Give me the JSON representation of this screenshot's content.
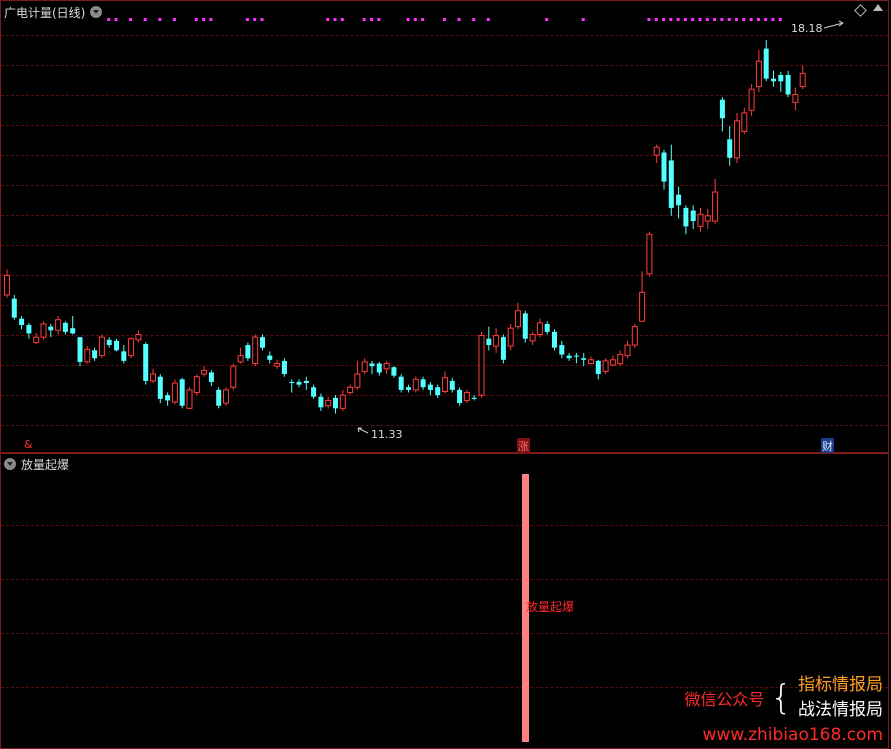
{
  "main_panel": {
    "title": "广电计量(日线)"
  },
  "sub_panel": {
    "title": "放量起爆",
    "bar_label": "放量起爆"
  },
  "signals": {
    "left_marker": "&",
    "up_badge": "涨",
    "fin_badge": "财"
  },
  "annotations": {
    "high_price": "18.18",
    "low_price": "11.33"
  },
  "watermark": {
    "wechat": "微信公众号",
    "brace": "{",
    "name1": "指标情报局",
    "name2": "战法情报局",
    "url": "www.zhibiao168.com"
  },
  "colors": {
    "bull": "#ff3c3c",
    "bear": "#54ffff",
    "dots": "#ff33ff",
    "volume_bar": "#ff8080"
  },
  "chart_data": {
    "type": "candlestick",
    "price_range": [
      10.6,
      18.6
    ],
    "candles": [
      [
        13.35,
        13.72,
        13.83,
        13.3
      ],
      [
        13.28,
        12.92,
        13.35,
        12.88
      ],
      [
        12.9,
        12.78,
        12.95,
        12.7
      ],
      [
        12.78,
        12.62,
        12.82,
        12.52
      ],
      [
        12.45,
        12.55,
        12.63,
        12.42
      ],
      [
        12.55,
        12.8,
        12.85,
        12.5
      ],
      [
        12.75,
        12.68,
        12.8,
        12.55
      ],
      [
        12.68,
        12.88,
        12.95,
        12.6
      ],
      [
        12.82,
        12.65,
        12.85,
        12.6
      ],
      [
        12.72,
        12.62,
        12.95,
        12.6
      ],
      [
        12.55,
        12.08,
        12.55,
        12.0
      ],
      [
        12.08,
        12.32,
        12.38,
        12.05
      ],
      [
        12.3,
        12.15,
        12.35,
        12.1
      ],
      [
        12.2,
        12.55,
        12.6,
        12.15
      ],
      [
        12.5,
        12.4,
        12.55,
        12.35
      ],
      [
        12.48,
        12.3,
        12.52,
        12.28
      ],
      [
        12.28,
        12.1,
        12.4,
        12.05
      ],
      [
        12.2,
        12.52,
        12.55,
        12.15
      ],
      [
        12.5,
        12.6,
        12.68,
        12.45
      ],
      [
        12.42,
        11.72,
        12.45,
        11.65
      ],
      [
        11.72,
        11.85,
        11.95,
        11.68
      ],
      [
        11.8,
        11.38,
        11.85,
        11.3
      ],
      [
        11.45,
        11.35,
        11.5,
        11.25
      ],
      [
        11.32,
        11.68,
        11.75,
        11.28
      ],
      [
        11.75,
        11.25,
        11.78,
        11.2
      ],
      [
        11.2,
        11.55,
        11.6,
        11.18
      ],
      [
        11.5,
        11.8,
        11.85,
        11.45
      ],
      [
        11.85,
        11.92,
        12.0,
        11.8
      ],
      [
        11.88,
        11.7,
        11.92,
        11.62
      ],
      [
        11.55,
        11.25,
        11.6,
        11.2
      ],
      [
        11.3,
        11.55,
        11.6,
        11.25
      ],
      [
        11.6,
        12.0,
        12.05,
        11.55
      ],
      [
        12.08,
        12.2,
        12.35,
        12.05
      ],
      [
        12.4,
        12.15,
        12.45,
        12.1
      ],
      [
        12.05,
        12.55,
        12.6,
        12.0
      ],
      [
        12.55,
        12.35,
        12.6,
        12.3
      ],
      [
        12.2,
        12.12,
        12.28,
        12.05
      ],
      [
        12.0,
        12.05,
        12.12,
        11.95
      ],
      [
        12.1,
        11.85,
        12.15,
        11.8
      ],
      [
        11.7,
        11.68,
        11.75,
        11.5
      ],
      [
        11.7,
        11.65,
        11.75,
        11.6
      ],
      [
        11.72,
        11.68,
        11.8,
        11.55
      ],
      [
        11.6,
        11.42,
        11.65,
        11.38
      ],
      [
        11.42,
        11.22,
        11.48,
        11.15
      ],
      [
        11.25,
        11.35,
        11.42,
        11.2
      ],
      [
        11.4,
        11.2,
        11.45,
        11.1
      ],
      [
        11.2,
        11.45,
        11.55,
        11.15
      ],
      [
        11.5,
        11.6,
        11.65,
        11.45
      ],
      [
        11.6,
        11.85,
        12.1,
        11.55
      ],
      [
        11.9,
        12.08,
        12.15,
        11.85
      ],
      [
        12.05,
        12.0,
        12.1,
        11.85
      ],
      [
        12.05,
        11.88,
        12.08,
        11.82
      ],
      [
        11.95,
        12.05,
        12.1,
        11.85
      ],
      [
        11.98,
        11.82,
        12.0,
        11.78
      ],
      [
        11.8,
        11.55,
        11.85,
        11.5
      ],
      [
        11.6,
        11.55,
        11.65,
        11.5
      ],
      [
        11.55,
        11.75,
        11.8,
        11.5
      ],
      [
        11.75,
        11.6,
        11.8,
        11.55
      ],
      [
        11.65,
        11.55,
        11.7,
        11.45
      ],
      [
        11.6,
        11.45,
        11.65,
        11.4
      ],
      [
        11.52,
        11.78,
        11.9,
        11.48
      ],
      [
        11.72,
        11.55,
        11.78,
        11.5
      ],
      [
        11.55,
        11.3,
        11.6,
        11.25
      ],
      [
        11.35,
        11.5,
        11.55,
        11.3
      ],
      [
        11.4,
        11.38,
        11.45,
        11.35
      ],
      [
        11.45,
        12.58,
        12.65,
        11.4
      ],
      [
        12.52,
        12.4,
        12.75,
        12.3
      ],
      [
        12.38,
        12.58,
        12.72,
        12.25
      ],
      [
        12.55,
        12.12,
        12.6,
        12.05
      ],
      [
        12.38,
        12.72,
        12.8,
        12.3
      ],
      [
        12.75,
        13.05,
        13.2,
        12.7
      ],
      [
        13.0,
        12.52,
        13.05,
        12.45
      ],
      [
        12.48,
        12.6,
        12.65,
        12.4
      ],
      [
        12.6,
        12.82,
        12.9,
        12.55
      ],
      [
        12.8,
        12.65,
        12.85,
        12.6
      ],
      [
        12.65,
        12.35,
        12.7,
        12.3
      ],
      [
        12.4,
        12.22,
        12.48,
        12.15
      ],
      [
        12.2,
        12.15,
        12.25,
        12.1
      ],
      [
        12.2,
        12.18,
        12.25,
        12.05
      ],
      [
        12.15,
        12.12,
        12.25,
        12.0
      ],
      [
        12.05,
        12.12,
        12.18,
        12.05
      ],
      [
        12.1,
        11.85,
        12.12,
        11.75
      ],
      [
        11.9,
        12.1,
        12.15,
        11.85
      ],
      [
        12.02,
        12.12,
        12.2,
        12.0
      ],
      [
        12.05,
        12.22,
        12.3,
        12.0
      ],
      [
        12.2,
        12.4,
        12.48,
        12.15
      ],
      [
        12.4,
        12.75,
        12.8,
        12.35
      ],
      [
        12.85,
        13.4,
        13.8,
        12.85
      ],
      [
        13.75,
        14.5,
        14.55,
        13.7
      ],
      [
        16.0,
        16.15,
        16.2,
        15.85
      ],
      [
        16.05,
        15.5,
        16.1,
        15.35
      ],
      [
        15.9,
        15.0,
        16.2,
        14.85
      ],
      [
        15.25,
        15.05,
        15.4,
        14.8
      ],
      [
        15.0,
        14.65,
        15.05,
        14.5
      ],
      [
        14.95,
        14.75,
        15.05,
        14.6
      ],
      [
        14.65,
        14.88,
        15.0,
        14.55
      ],
      [
        14.75,
        14.85,
        14.98,
        14.6
      ],
      [
        14.75,
        15.3,
        15.55,
        14.7
      ],
      [
        17.05,
        16.7,
        17.1,
        16.45
      ],
      [
        16.3,
        15.95,
        16.55,
        15.8
      ],
      [
        15.95,
        16.65,
        16.8,
        15.85
      ],
      [
        16.45,
        16.8,
        16.9,
        16.4
      ],
      [
        16.85,
        17.25,
        17.35,
        16.75
      ],
      [
        17.3,
        17.78,
        18.0,
        17.2
      ],
      [
        18.02,
        17.45,
        18.18,
        17.4
      ],
      [
        17.45,
        17.4,
        17.6,
        17.3
      ],
      [
        17.52,
        17.4,
        17.58,
        17.2
      ],
      [
        17.52,
        17.15,
        17.6,
        17.1
      ],
      [
        17.0,
        17.15,
        17.28,
        16.85
      ],
      [
        17.3,
        17.55,
        17.7,
        17.25
      ]
    ],
    "top_dots": [
      14,
      15,
      17,
      19,
      21,
      23,
      26,
      27,
      28,
      33,
      34,
      35,
      44,
      45,
      46,
      49,
      50,
      51,
      55,
      56,
      57,
      60,
      62,
      64,
      66,
      74,
      79,
      88,
      89,
      90,
      91,
      92,
      93,
      94,
      95,
      96,
      97,
      98,
      99,
      100,
      101,
      102,
      103,
      104,
      105,
      106
    ]
  }
}
